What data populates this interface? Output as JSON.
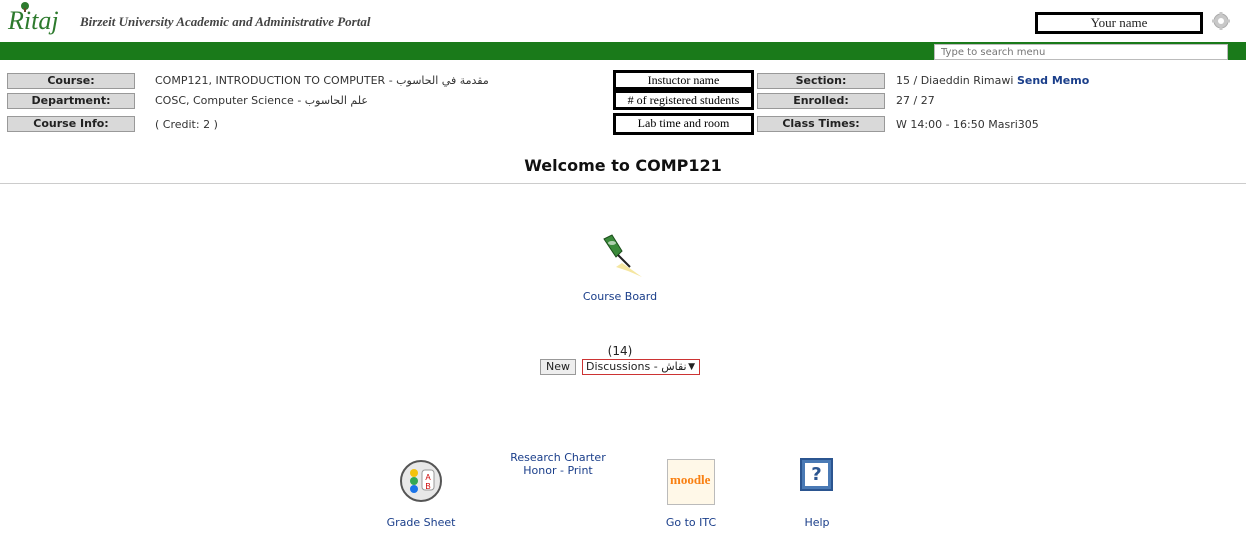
{
  "header": {
    "logo_text": "Ritaj",
    "portal_title": "Birzeit University Academic and Administrative Portal",
    "user_name": "Your name"
  },
  "search": {
    "placeholder": "Type to search menu"
  },
  "course_info": {
    "course_label": "Course:",
    "course_value": "COMP121, INTRODUCTION TO COMPUTER - مقدمة في الحاسوب",
    "department_label": "Department:",
    "department_value": "COSC, Computer Science - علم الحاسوب",
    "info_label": "Course Info:",
    "info_value": "( Credit: 2 )",
    "instructor_box": "Instuctor name",
    "students_box": "# of registered students",
    "lab_box": "Lab time and room",
    "section_label": "Section:",
    "section_value": "15 / Diaeddin Rimawi",
    "send_memo": "Send Memo",
    "enrolled_label": "Enrolled:",
    "enrolled_value": "27 / 27",
    "class_times_label": "Class Times:",
    "class_times_value": "W 14:00 - 16:50 Masri305"
  },
  "welcome": "Welcome to COMP121",
  "course_board": {
    "label": "Course Board",
    "icon": "pushpin-icon"
  },
  "discussions": {
    "count": "(14)",
    "new_button": "New",
    "selected": "Discussions - نقاش"
  },
  "bottom_links": {
    "grade_sheet": "Grade Sheet",
    "research_charter_line1": "Research Charter",
    "research_charter_line2": "Honor - Print",
    "go_to_itc": "Go to ITC",
    "help": "Help",
    "moodle_logo_text": "moodle"
  }
}
